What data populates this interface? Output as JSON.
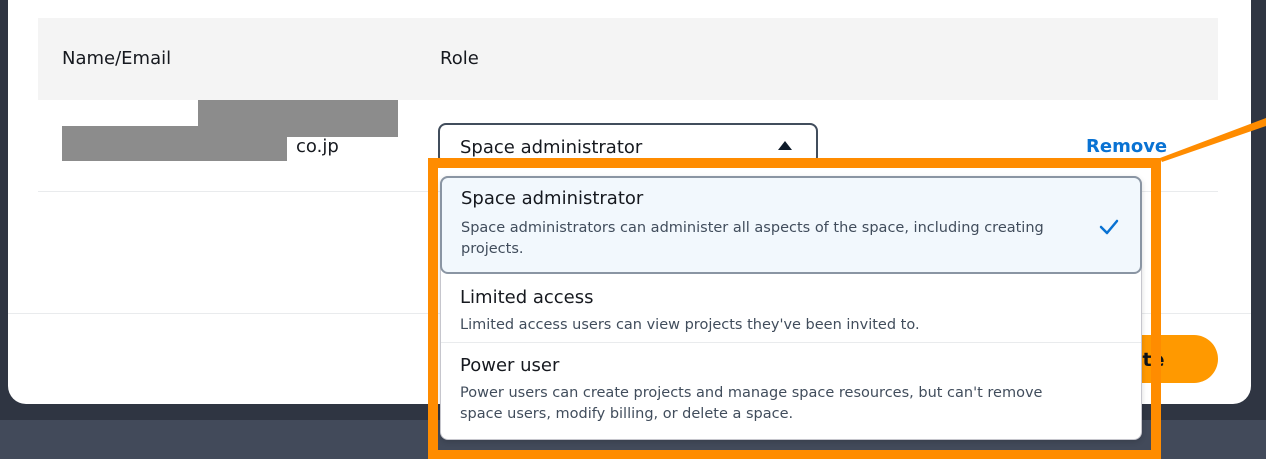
{
  "table": {
    "col_name": "Name/Email",
    "col_role": "Role"
  },
  "member": {
    "email_suffix": "co.jp",
    "role_value": "Space administrator",
    "remove_label": "Remove"
  },
  "footer": {
    "invite_label": "ite"
  },
  "role_dropdown": {
    "options": [
      {
        "title": "Space administrator",
        "description": "Space administrators can administer all aspects of the space, including creating projects.",
        "selected": true
      },
      {
        "title": "Limited access",
        "description": "Limited access users can view projects they've been invited to.",
        "selected": false
      },
      {
        "title": "Power user",
        "description": "Power users can create projects and manage space resources, but can't remove space users, modify billing, or delete a space.",
        "selected": false
      }
    ]
  },
  "colors": {
    "accent": "#ff9900",
    "highlight": "#ff8c00",
    "link": "#0972d3",
    "backdrop": "#2f3542"
  },
  "icons": [
    "caret-up-icon",
    "check-icon"
  ]
}
